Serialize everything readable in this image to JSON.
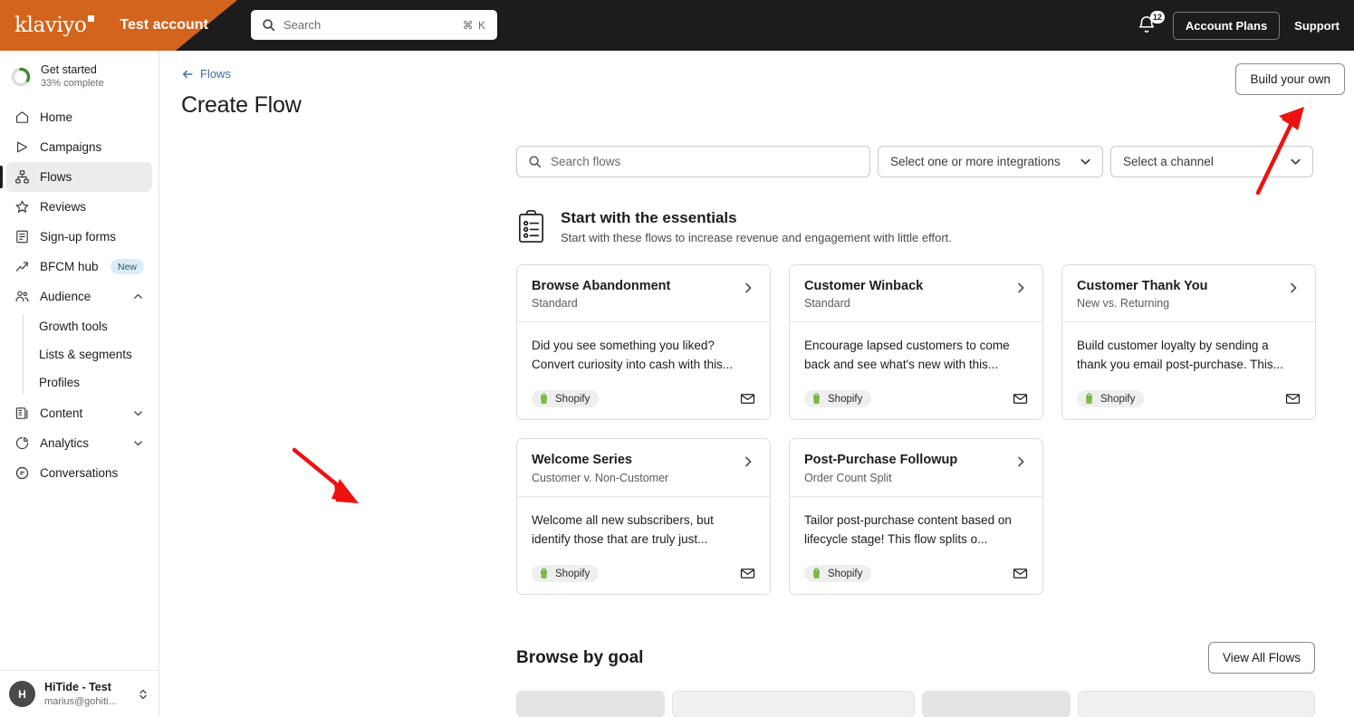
{
  "topbar": {
    "logo_text": "klaviyo",
    "logo_icon": "klaviyo-square-mark",
    "account_name": "Test account",
    "search": {
      "icon": "search-icon",
      "placeholder": "Search",
      "shortcut": "⌘ K"
    },
    "notifications": {
      "icon": "bell-icon",
      "count": "12"
    },
    "account_plans_label": "Account Plans",
    "support_label": "Support"
  },
  "sidebar": {
    "get_started": {
      "title": "Get started",
      "subtitle": "33% complete",
      "progress": 33,
      "icon": "progress-ring-icon"
    },
    "items": [
      {
        "label": "Home",
        "icon": "home-icon"
      },
      {
        "label": "Campaigns",
        "icon": "megaphone-icon"
      },
      {
        "label": "Flows",
        "icon": "flows-icon",
        "active": true
      },
      {
        "label": "Reviews",
        "icon": "star-icon"
      },
      {
        "label": "Sign-up forms",
        "icon": "form-icon"
      },
      {
        "label": "BFCM hub",
        "icon": "trending-up-icon",
        "badge": "New"
      },
      {
        "label": "Audience",
        "icon": "people-icon",
        "expanded": true
      },
      {
        "label": "Content",
        "icon": "content-icon",
        "expanded": false
      },
      {
        "label": "Analytics",
        "icon": "pie-chart-icon",
        "expanded": false
      },
      {
        "label": "Conversations",
        "icon": "chat-icon"
      }
    ],
    "audience_children": [
      {
        "label": "Growth tools"
      },
      {
        "label": "Lists & segments"
      },
      {
        "label": "Profiles"
      }
    ],
    "user": {
      "initial": "H",
      "name": "HiTide - Test",
      "email": "marius@gohiti...",
      "switcher_icon": "up-down-chevron-icon"
    }
  },
  "page": {
    "breadcrumb": {
      "label": "Flows",
      "icon": "arrow-left-icon"
    },
    "title": "Create Flow",
    "build_your_own_label": "Build your own"
  },
  "filters": {
    "search": {
      "icon": "search-icon",
      "placeholder": "Search flows",
      "value": ""
    },
    "integrations_select": {
      "label": "Select one or more integrations",
      "icon": "chevron-down-icon"
    },
    "channel_select": {
      "label": "Select a channel",
      "icon": "chevron-down-icon"
    }
  },
  "essentials": {
    "icon": "clipboard-checklist-icon",
    "title": "Start with the essentials",
    "subtitle": "Start with these flows to increase revenue and engagement with little effort.",
    "cards": [
      {
        "title": "Browse Abandonment",
        "subtitle": "Standard",
        "description": "Did you see something you liked? Convert curiosity into cash with this...",
        "integration": "Shopify",
        "integration_icon": "shopify-bag-icon",
        "channel_icon": "envelope-icon",
        "chevron_icon": "chevron-right-icon"
      },
      {
        "title": "Customer Winback",
        "subtitle": "Standard",
        "description": "Encourage lapsed customers to come back and see what's new with this...",
        "integration": "Shopify",
        "integration_icon": "shopify-bag-icon",
        "channel_icon": "envelope-icon",
        "chevron_icon": "chevron-right-icon"
      },
      {
        "title": "Customer Thank You",
        "subtitle": "New vs. Returning",
        "description": "Build customer loyalty by sending a thank you email post-purchase. This...",
        "integration": "Shopify",
        "integration_icon": "shopify-bag-icon",
        "channel_icon": "envelope-icon",
        "chevron_icon": "chevron-right-icon"
      },
      {
        "title": "Welcome Series",
        "subtitle": "Customer v. Non-Customer",
        "description": "Welcome all new subscribers, but identify those that are truly just...",
        "integration": "Shopify",
        "integration_icon": "shopify-bag-icon",
        "channel_icon": "envelope-icon",
        "chevron_icon": "chevron-right-icon"
      },
      {
        "title": "Post-Purchase Followup",
        "subtitle": "Order Count Split",
        "description": "Tailor post-purchase content based on lifecycle stage! This flow splits o...",
        "integration": "Shopify",
        "integration_icon": "shopify-bag-icon",
        "channel_icon": "envelope-icon",
        "chevron_icon": "chevron-right-icon"
      }
    ]
  },
  "browse_by_goal": {
    "title": "Browse by goal",
    "view_all_label": "View All Flows"
  },
  "annotations": [
    {
      "name": "arrow-to-build-your-own",
      "color": "#ee1111"
    },
    {
      "name": "arrow-to-welcome-series",
      "color": "#ee1111"
    }
  ],
  "colors": {
    "brand_orange": "#d2641e",
    "topbar_dark": "#1c1c1c",
    "link_blue": "#3b6ea8",
    "badge_new_bg": "#dcecf7",
    "progress_green": "#3f8a2e",
    "annotation_red": "#ee1111"
  }
}
